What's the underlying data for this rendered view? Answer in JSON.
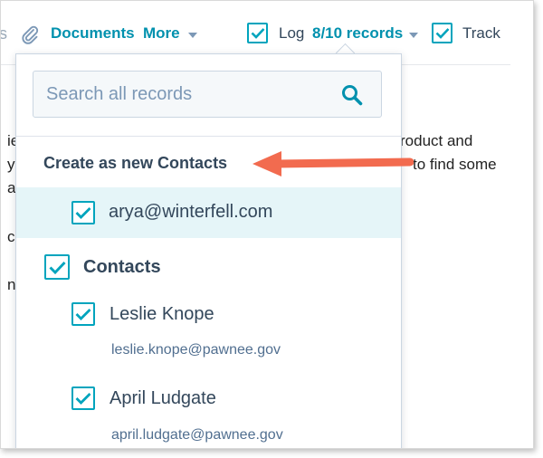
{
  "toolbar": {
    "partial_text": "s",
    "documents": "Documents",
    "more": "More",
    "log_label": "Log",
    "records": "8/10 records",
    "track": "Track"
  },
  "background_text": {
    "line1_left": "ie",
    "line1_right": "roduct and",
    "line2_left": "y",
    "line2_right": "to find some",
    "line3_left": "a",
    "line4_left": "c",
    "line5_left": "n"
  },
  "dropdown": {
    "search_placeholder": "Search all records",
    "new_section_title": "Create as new Contacts",
    "new_contact_email": "arya@winterfell.com",
    "group_title": "Contacts",
    "contacts": [
      {
        "name": "Leslie Knope",
        "email": "leslie.knope@pawnee.gov"
      },
      {
        "name": "April Ludgate",
        "email": "april.ludgate@pawnee.gov"
      }
    ]
  },
  "colors": {
    "accent": "#00a4bd",
    "link": "#0091ae",
    "text": "#33475b",
    "highlight_row": "#e5f5f8",
    "annotation_arrow": "#f26b4f"
  }
}
